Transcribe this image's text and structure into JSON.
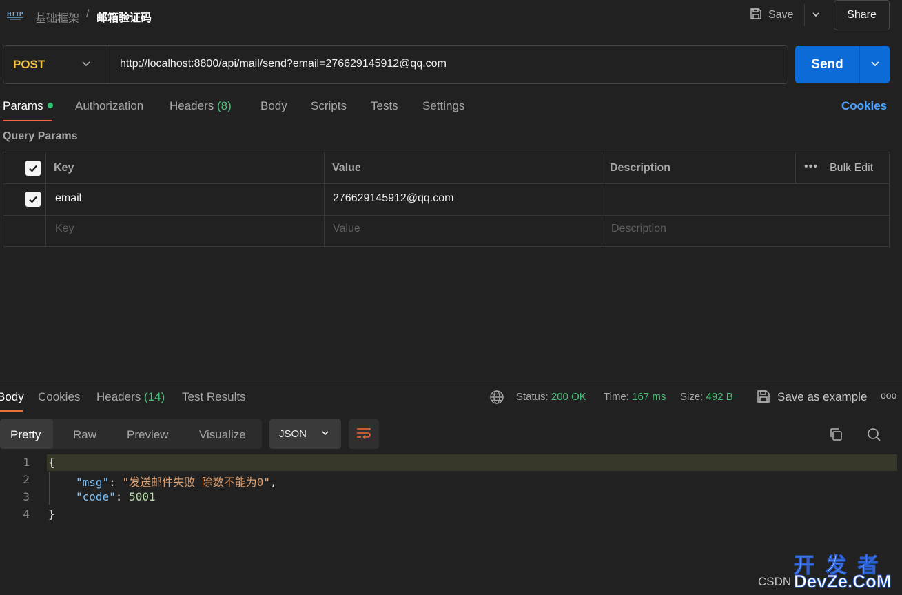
{
  "header": {
    "breadcrumb_parent": "基础框架",
    "breadcrumb_sep": "/",
    "breadcrumb_current": "邮箱验证码",
    "save_label": "Save",
    "share_label": "Share"
  },
  "request": {
    "method": "POST",
    "url": "http://localhost:8800/api/mail/send?email=276629145912@qq.com",
    "send_label": "Send"
  },
  "tabs": {
    "params": "Params",
    "authorization": "Authorization",
    "headers": "Headers",
    "headers_count": "(8)",
    "body": "Body",
    "scripts": "Scripts",
    "tests": "Tests",
    "settings": "Settings",
    "cookies": "Cookies"
  },
  "params": {
    "title": "Query Params",
    "columns": {
      "key": "Key",
      "value": "Value",
      "description": "Description",
      "bulk_edit": "Bulk Edit"
    },
    "rows": [
      {
        "key": "email",
        "value": "276629145912@qq.com",
        "description": ""
      }
    ],
    "placeholder": {
      "key": "Key",
      "value": "Value",
      "description": "Description"
    }
  },
  "response": {
    "tabs": {
      "body": "Body",
      "cookies": "Cookies",
      "headers": "Headers",
      "headers_count": "(14)",
      "test_results": "Test Results"
    },
    "status_label": "Status:",
    "status_value": "200 OK",
    "time_label": "Time:",
    "time_value": "167 ms",
    "size_label": "Size:",
    "size_value": "492 B",
    "save_example": "Save as example",
    "formats": {
      "pretty": "Pretty",
      "raw": "Raw",
      "preview": "Preview",
      "visualize": "Visualize"
    },
    "language": "JSON",
    "code": {
      "line_numbers": [
        "1",
        "2",
        "3",
        "4"
      ],
      "open": "{",
      "close": "}",
      "msg_key": "\"msg\"",
      "msg_value": "\"发送邮件失败 除数不能为0\"",
      "code_key": "\"code\"",
      "code_value": "5001"
    }
  },
  "watermark": {
    "csdn": "CSDN",
    "cn": "开 发 者",
    "en": "DevZe.CoM"
  },
  "colors": {
    "accent": "#f26b3a",
    "send": "#0d6bd8",
    "method": "#f5c542",
    "success": "#49c27a",
    "link": "#4fa3ff"
  }
}
